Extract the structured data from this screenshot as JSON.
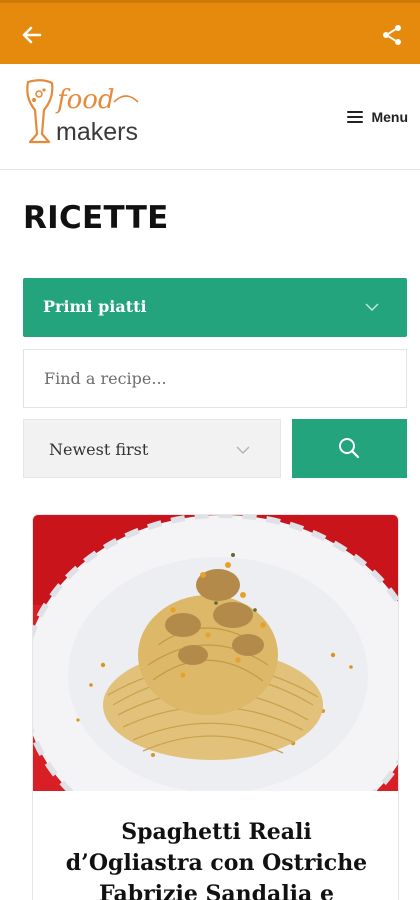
{
  "appbar": {
    "background": "#e58a0c",
    "back_icon": "arrow-left-icon",
    "share_icon": "share-icon"
  },
  "header": {
    "logo": {
      "word1": "food",
      "word2": "makers"
    },
    "menu_label": "Menu",
    "menu_icon": "hamburger-icon"
  },
  "page": {
    "title": "RICETTE"
  },
  "filters": {
    "category": {
      "selected": "Primi piatti"
    },
    "search": {
      "placeholder": "Find a recipe..."
    },
    "sort": {
      "selected": "Newest first"
    },
    "search_button_icon": "search-icon",
    "accent": "#23a47d"
  },
  "recipe_card": {
    "title": "Spaghetti Reali d’Ogliastra con Ostriche Fabrizie Sandalia e"
  }
}
